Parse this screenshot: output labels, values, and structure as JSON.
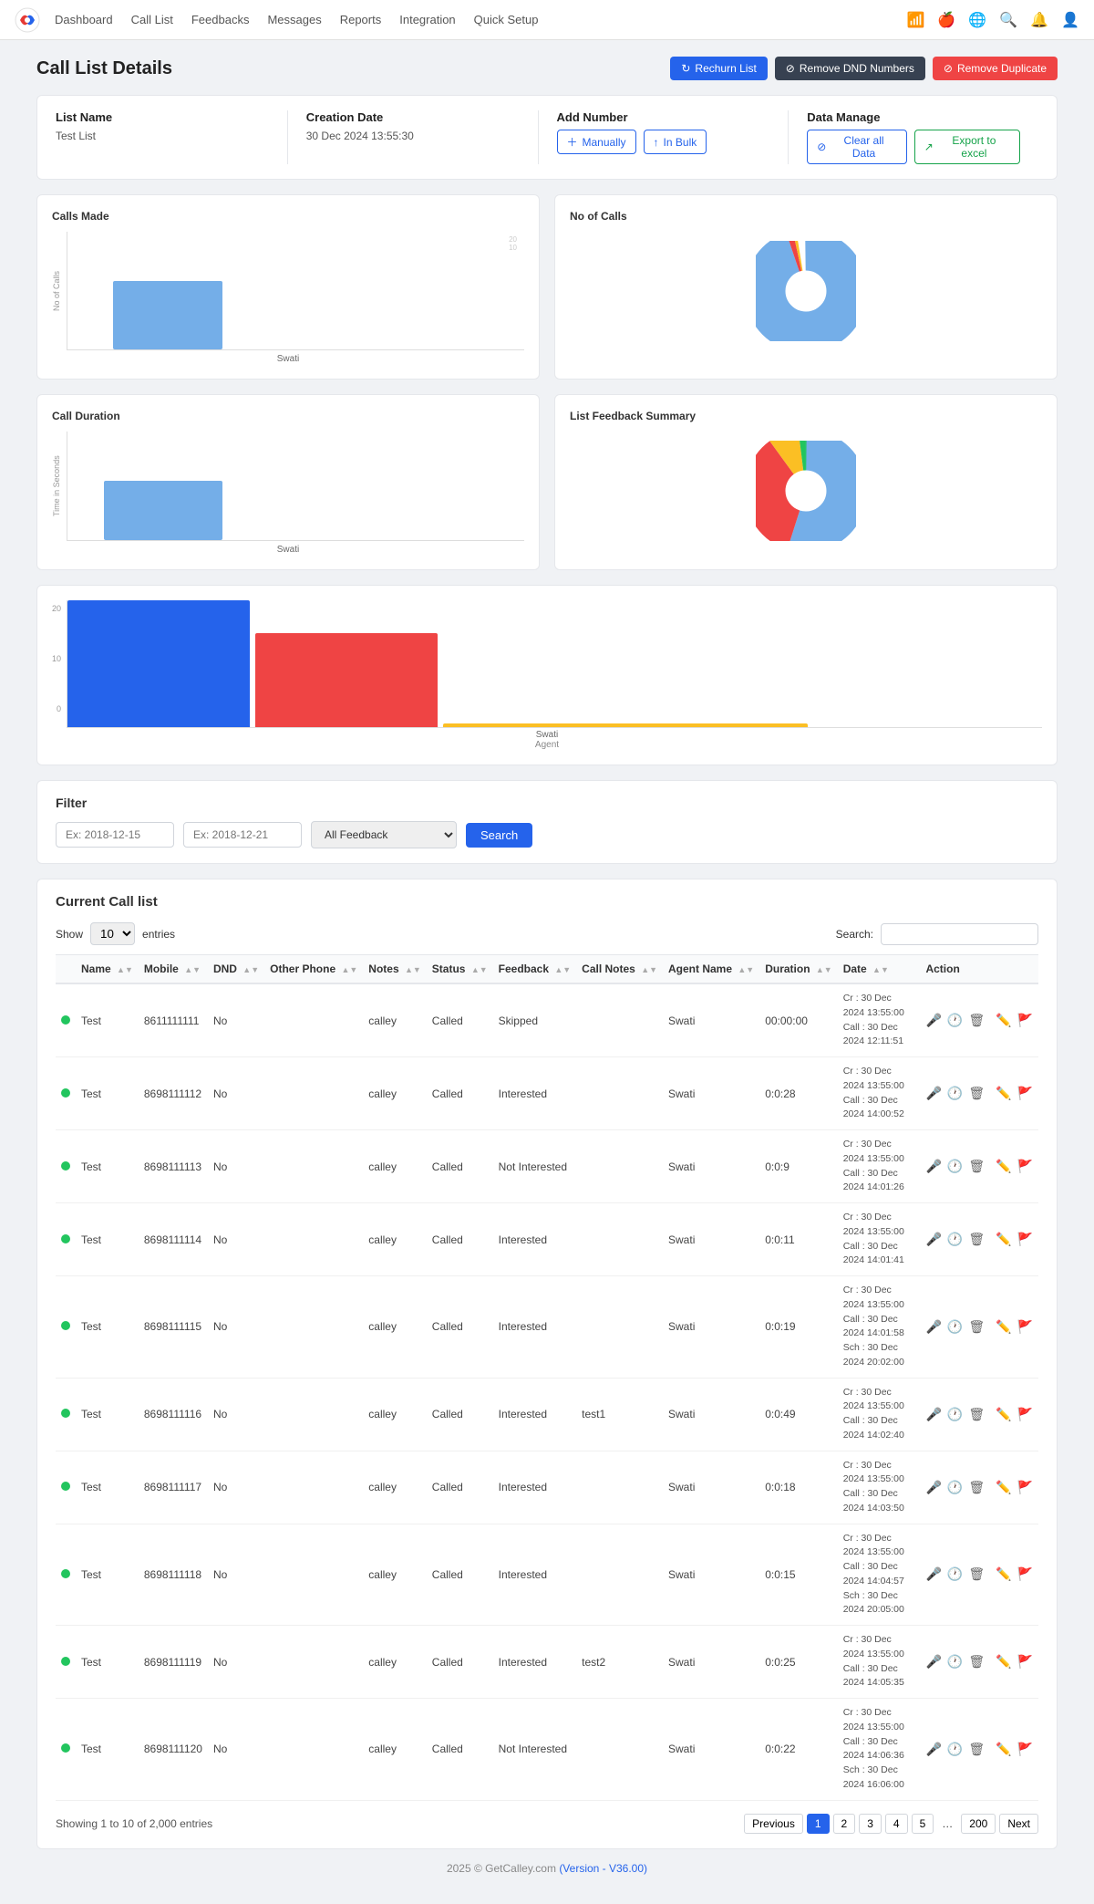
{
  "nav": {
    "logo_alt": "Calley logo",
    "links": [
      "Dashboard",
      "Call List",
      "Feedbacks",
      "Messages",
      "Reports",
      "Integration",
      "Quick Setup"
    ]
  },
  "page": {
    "title": "Call List Details",
    "buttons": {
      "rechurn": "Rechurn List",
      "remove_dnd": "Remove DND Numbers",
      "remove_duplicate": "Remove Duplicate"
    }
  },
  "list_info": {
    "list_name_label": "List Name",
    "list_name_value": "Test List",
    "creation_date_label": "Creation Date",
    "creation_date_value": "30 Dec 2024 13:55:30",
    "add_number_label": "Add Number",
    "manually_btn": "Manually",
    "in_bulk_btn": "In Bulk",
    "data_manage_label": "Data Manage",
    "clear_btn": "Clear all Data",
    "export_btn": "Export to excel"
  },
  "charts": {
    "calls_made_title": "Calls Made",
    "calls_made_y_label": "No of Calls",
    "calls_made_x_label": "Swati",
    "no_of_calls_title": "No of Calls",
    "call_duration_title": "Call Duration",
    "call_duration_y_label": "Time in Seconds",
    "call_duration_x_label": "Swati",
    "list_feedback_title": "List Feedback Summary",
    "agent_chart_y_values": [
      "20",
      "10",
      "0"
    ],
    "agent_chart_x_label": "Swati",
    "agent_chart_label": "Agent"
  },
  "filter": {
    "title": "Filter",
    "date_from_placeholder": "Ex: 2018-12-15",
    "date_to_placeholder": "Ex: 2018-12-21",
    "feedback_option": "All Feedback",
    "search_btn": "Search"
  },
  "table": {
    "section_title": "Current Call list",
    "show_label": "Show",
    "entries_label": "entries",
    "search_label": "Search:",
    "show_value": "10",
    "columns": [
      "",
      "Name",
      "Mobile",
      "DND",
      "Other Phone",
      "Notes",
      "Status",
      "Feedback",
      "Call Notes",
      "Agent Name",
      "Duration",
      "Date",
      "Action"
    ],
    "rows": [
      {
        "name": "Test",
        "mobile": "8611111111",
        "dnd": "No",
        "other_phone": "",
        "notes": "calley",
        "status": "Called",
        "feedback": "Skipped",
        "call_notes": "",
        "agent": "Swati",
        "duration": "00:00:00",
        "date_cr": "Cr : 30 Dec 2024 13:55:00",
        "date_call": "Call : 30 Dec 2024 12:11:51",
        "date_sch": ""
      },
      {
        "name": "Test",
        "mobile": "8698111112",
        "dnd": "No",
        "other_phone": "",
        "notes": "calley",
        "status": "Called",
        "feedback": "Interested",
        "call_notes": "",
        "agent": "Swati",
        "duration": "0:0:28",
        "date_cr": "Cr : 30 Dec 2024 13:55:00",
        "date_call": "Call : 30 Dec 2024 14:00:52",
        "date_sch": ""
      },
      {
        "name": "Test",
        "mobile": "8698111113",
        "dnd": "No",
        "other_phone": "",
        "notes": "calley",
        "status": "Called",
        "feedback": "Not Interested",
        "call_notes": "",
        "agent": "Swati",
        "duration": "0:0:9",
        "date_cr": "Cr : 30 Dec 2024 13:55:00",
        "date_call": "Call : 30 Dec 2024 14:01:26",
        "date_sch": ""
      },
      {
        "name": "Test",
        "mobile": "8698111114",
        "dnd": "No",
        "other_phone": "",
        "notes": "calley",
        "status": "Called",
        "feedback": "Interested",
        "call_notes": "",
        "agent": "Swati",
        "duration": "0:0:11",
        "date_cr": "Cr : 30 Dec 2024 13:55:00",
        "date_call": "Call : 30 Dec 2024 14:01:41",
        "date_sch": ""
      },
      {
        "name": "Test",
        "mobile": "8698111115",
        "dnd": "No",
        "other_phone": "",
        "notes": "calley",
        "status": "Called",
        "feedback": "Interested",
        "call_notes": "",
        "agent": "Swati",
        "duration": "0:0:19",
        "date_cr": "Cr : 30 Dec 2024 13:55:00",
        "date_call": "Call : 30 Dec 2024 14:01:58",
        "date_sch": "Sch : 30 Dec 2024 20:02:00"
      },
      {
        "name": "Test",
        "mobile": "8698111116",
        "dnd": "No",
        "other_phone": "",
        "notes": "calley",
        "status": "Called",
        "feedback": "Interested",
        "call_notes": "test1",
        "agent": "Swati",
        "duration": "0:0:49",
        "date_cr": "Cr : 30 Dec 2024 13:55:00",
        "date_call": "Call : 30 Dec 2024 14:02:40",
        "date_sch": ""
      },
      {
        "name": "Test",
        "mobile": "8698111117",
        "dnd": "No",
        "other_phone": "",
        "notes": "calley",
        "status": "Called",
        "feedback": "Interested",
        "call_notes": "",
        "agent": "Swati",
        "duration": "0:0:18",
        "date_cr": "Cr : 30 Dec 2024 13:55:00",
        "date_call": "Call : 30 Dec 2024 14:03:50",
        "date_sch": ""
      },
      {
        "name": "Test",
        "mobile": "8698111118",
        "dnd": "No",
        "other_phone": "",
        "notes": "calley",
        "status": "Called",
        "feedback": "Interested",
        "call_notes": "",
        "agent": "Swati",
        "duration": "0:0:15",
        "date_cr": "Cr : 30 Dec 2024 13:55:00",
        "date_call": "Call : 30 Dec 2024 14:04:57",
        "date_sch": "Sch : 30 Dec 2024 20:05:00"
      },
      {
        "name": "Test",
        "mobile": "8698111119",
        "dnd": "No",
        "other_phone": "",
        "notes": "calley",
        "status": "Called",
        "feedback": "Interested",
        "call_notes": "test2",
        "agent": "Swati",
        "duration": "0:0:25",
        "date_cr": "Cr : 30 Dec 2024 13:55:00",
        "date_call": "Call : 30 Dec 2024 14:05:35",
        "date_sch": ""
      },
      {
        "name": "Test",
        "mobile": "8698111120",
        "dnd": "No",
        "other_phone": "",
        "notes": "calley",
        "status": "Called",
        "feedback": "Not Interested",
        "call_notes": "",
        "agent": "Swati",
        "duration": "0:0:22",
        "date_cr": "Cr : 30 Dec 2024 13:55:00",
        "date_call": "Call : 30 Dec 2024 14:06:36",
        "date_sch": "Sch : 30 Dec 2024 16:06:00"
      }
    ],
    "showing_text": "Showing 1 to 10 of 2,000 entries",
    "pagination": {
      "previous": "Previous",
      "next": "Next",
      "pages": [
        "1",
        "2",
        "3",
        "4",
        "5",
        "...",
        "200"
      ]
    }
  },
  "footer": {
    "text": "2025 © GetCalley.com",
    "version": "(Version - V36.00)"
  }
}
